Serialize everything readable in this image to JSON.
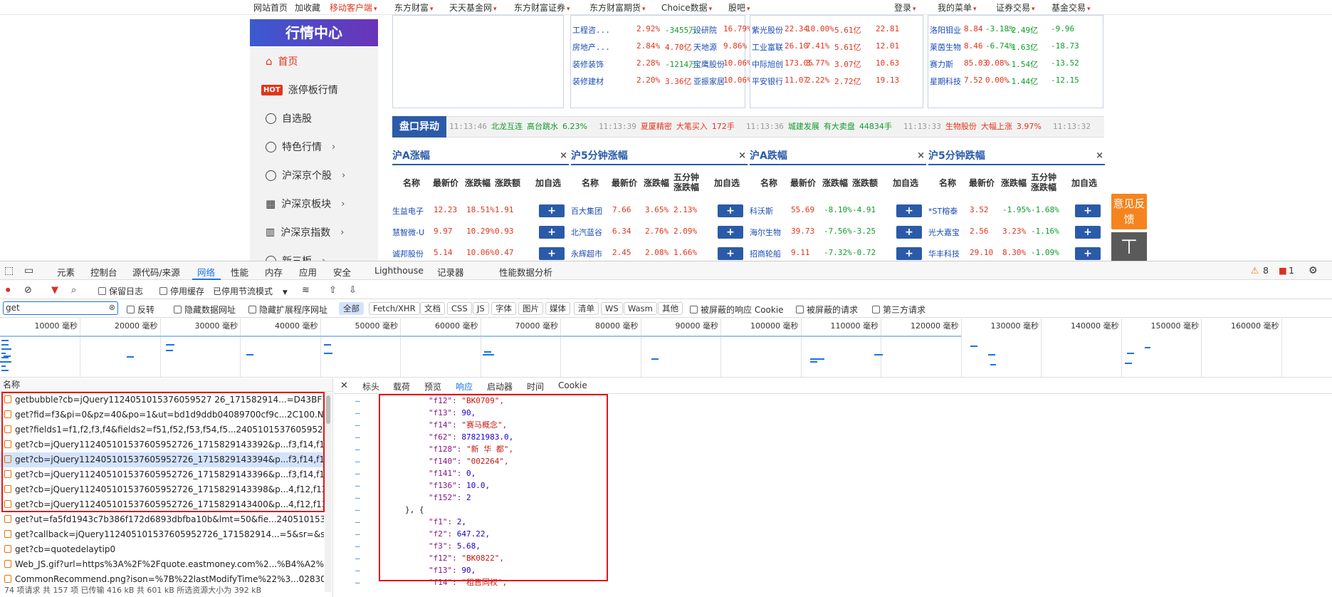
{
  "topnav": {
    "items": [
      "网站首页",
      "加收藏",
      "移动客户端",
      "东方财富",
      "天天基金网",
      "东方财富证券",
      "东方财富期货",
      "Choice数据",
      "股吧",
      "登录",
      "我的菜单",
      "证券交易",
      "基金交易"
    ]
  },
  "logo": "行情中心",
  "sidebar": {
    "items": [
      "首页",
      "涨停板行情",
      "自选股",
      "特色行情",
      "沪深京个股",
      "沪深京板块",
      "沪深京指数",
      "新三板"
    ],
    "hot": "HOT"
  },
  "top_tables": {
    "col1": [
      [
        "工程咨...",
        "2.92%",
        "-3455万",
        "设研院",
        "16.79%"
      ],
      [
        "房地产...",
        "2.84%",
        "4.70亿",
        "天地源",
        "9.86%"
      ],
      [
        "装修装饰",
        "2.28%",
        "-1214万",
        "宝鹰股份",
        "10.06%"
      ],
      [
        "装修建材",
        "2.20%",
        "3.36亿",
        "亚振家居",
        "10.06%"
      ]
    ],
    "col2": [
      [
        "紫光股份",
        "22.34",
        "10.00%",
        "5.61亿",
        "22.81"
      ],
      [
        "工业富联",
        "26.10",
        "7.41%",
        "5.61亿",
        "12.01"
      ],
      [
        "中际旭创",
        "173.05",
        "3.77%",
        "3.07亿",
        "10.63"
      ],
      [
        "平安银行",
        "11.07",
        "2.22%",
        "2.72亿",
        "19.13"
      ]
    ],
    "col3": [
      [
        "洛阳钼业",
        "8.84",
        "-3.18%",
        "-2.49亿",
        "-9.96"
      ],
      [
        "莱茵生物",
        "8.46",
        "-6.74%",
        "-1.63亿",
        "-18.73"
      ],
      [
        "赛力斯",
        "85.03",
        "0.08%",
        "-1.54亿",
        "-13.52"
      ],
      [
        "星期科技",
        "7.52",
        "0.00%",
        "-1.44亿",
        "-12.15"
      ]
    ]
  },
  "yidong": {
    "label": "盘口异动",
    "items": [
      [
        "11:13:46",
        "北龙互连",
        "高台跳水",
        "6.23%",
        "green"
      ],
      [
        "11:13:39",
        "夏厦精密",
        "大笔买入",
        "172手",
        "red"
      ],
      [
        "11:13:36",
        "城建发展",
        "有大卖盘",
        "44834手",
        "green"
      ],
      [
        "11:13:33",
        "生物股份",
        "大幅上涨",
        "3.97%",
        "red"
      ],
      [
        "11:13:32",
        "",
        "",
        "",
        ""
      ]
    ]
  },
  "panels": [
    {
      "title": "沪A涨幅",
      "x": "×",
      "headers": [
        "名称",
        "最新价",
        "涨跌幅",
        "涨跌额",
        "加自选"
      ],
      "rows": [
        [
          "生益电子",
          "12.23",
          "18.51%",
          "1.91"
        ],
        [
          "慧智微-U",
          "9.97",
          "10.29%",
          "0.93"
        ],
        [
          "诚邦股份",
          "5.14",
          "10.06%",
          "0.47"
        ]
      ]
    },
    {
      "title": "沪5分钟涨幅",
      "x": "×",
      "headers": [
        "名称",
        "最新价",
        "涨跌幅",
        "五分钟涨跌幅",
        "加自选"
      ],
      "rows": [
        [
          "百大集团",
          "7.66",
          "3.65%",
          "2.13%"
        ],
        [
          "北汽蓝谷",
          "6.34",
          "2.76%",
          "2.09%"
        ],
        [
          "永辉超市",
          "2.45",
          "2.08%",
          "1.66%"
        ]
      ]
    },
    {
      "title": "沪A跌幅",
      "x": "×",
      "headers": [
        "名称",
        "最新价",
        "涨跌幅",
        "涨跌额",
        "加自选"
      ],
      "rows": [
        [
          "科沃斯",
          "55.69",
          "-8.10%",
          "-4.91"
        ],
        [
          "海尔生物",
          "39.73",
          "-7.56%",
          "-3.25"
        ],
        [
          "招商轮船",
          "9.11",
          "-7.32%",
          "-0.72"
        ]
      ]
    },
    {
      "title": "沪5分钟跌幅",
      "x": "×",
      "headers": [
        "名称",
        "最新价",
        "涨跌幅",
        "五分钟涨跌幅",
        "加自选"
      ],
      "rows": [
        [
          "*ST榕泰",
          "3.52",
          "-1.95%",
          "-1.68%"
        ],
        [
          "光大嘉宝",
          "2.56",
          "3.23%",
          "-1.16%"
        ],
        [
          "华丰科技",
          "29.10",
          "8.30%",
          "-1.09%"
        ]
      ]
    }
  ],
  "plus": "+",
  "feedback": "意见反馈",
  "totop": "不",
  "devtools": {
    "tabs": [
      "元素",
      "控制台",
      "源代码/来源",
      "网络",
      "性能",
      "内存",
      "应用",
      "安全",
      "Lighthouse",
      "记录器",
      "性能数据分析"
    ],
    "warn": "8",
    "err": "1",
    "toolbar": [
      "保留日志",
      "停用缓存",
      "已停用节流模式"
    ],
    "filter_value": "get",
    "filter_opts": [
      "反转",
      "隐藏数据网址",
      "隐藏扩展程序网址"
    ],
    "chips": [
      "全部",
      "Fetch/XHR",
      "文档",
      "CSS",
      "JS",
      "字体",
      "图片",
      "媒体",
      "清单",
      "WS",
      "Wasm",
      "其他"
    ],
    "filter_opts2": [
      "被屏蔽的响应 Cookie",
      "被屏蔽的请求",
      "第三方请求"
    ],
    "ticks": [
      "10000 毫秒",
      "20000 毫秒",
      "30000 毫秒",
      "40000 毫秒",
      "50000 毫秒",
      "60000 毫秒",
      "70000 毫秒",
      "80000 毫秒",
      "90000 毫秒",
      "100000 毫秒",
      "110000 毫秒",
      "120000 毫秒",
      "130000 毫秒",
      "140000 毫秒",
      "150000 毫秒",
      "160000 毫秒",
      "1700"
    ],
    "name_header": "名称",
    "requests": [
      "getbubble?cb=jQuery1124051015376059527 26_171582914...=D43BF72...",
      "get?fid=f3&pi=0&pz=40&po=1&ut=bd1d9ddb04089700cf9c...2C100.N...",
      "get?fields1=f1,f2,f3,f4&fields2=f51,f52,f53,f54,f5...240510153760595272...",
      "get?cb=jQuery112405101537605952726_1715829143392&p...f3,f14,f12,...",
      "get?cb=jQuery112405101537605952726_1715829143394&p...f3,f14,f12,...",
      "get?cb=jQuery112405101537605952726_1715829143396&p...f3,f14,f12,...",
      "get?cb=jQuery112405101537605952726_1715829143398&p...4,f12,f13,f...",
      "get?cb=jQuery112405101537605952726_1715829143400&p...4,f12,f13,f...",
      "get?ut=fa5fd1943c7b386f172d6893dbfba10b&lmt=50&fie...240510153...",
      "get?callback=jQuery112405101537605952726_171582914...=5&sr=&st...",
      "get?cb=quotedelaytip0",
      "Web_JS.gif?url=https%3A%2F%2Fquote.eastmoney.com%2...%B4%A2%...",
      "CommonRecommend.png?ison=%7B%22lastModifyTime%22%3...02830..."
    ],
    "detail_tabs": [
      "标头",
      "载荷",
      "预览",
      "响应",
      "启动器",
      "时间",
      "Cookie"
    ],
    "code": [
      [
        "\"f12\": ",
        "\"BK0709\",",
        "s"
      ],
      [
        "\"f13\": ",
        "90,",
        "n"
      ],
      [
        "\"f14\": ",
        "\"赛马概念\",",
        "s"
      ],
      [
        "\"f62\": ",
        "87821983.0,",
        "n"
      ],
      [
        "\"f128\": ",
        "\"新 华 都\",",
        "s"
      ],
      [
        "\"f140\": ",
        "\"002264\",",
        "s"
      ],
      [
        "\"f141\": ",
        "0,",
        "n"
      ],
      [
        "\"f136\": ",
        "10.0,",
        "n"
      ],
      [
        "\"f152\": ",
        "2",
        "n"
      ],
      [
        "}, {",
        "",
        ""
      ],
      [
        "\"f1\": ",
        "2,",
        "n"
      ],
      [
        "\"f2\": ",
        "647.22,",
        "n"
      ],
      [
        "\"f3\": ",
        "5.68,",
        "n"
      ],
      [
        "\"f12\": ",
        "\"BK0822\",",
        "s"
      ],
      [
        "\"f13\": ",
        "90,",
        "n"
      ],
      [
        "\"f14\": ",
        "\"租售同权\",",
        "s"
      ]
    ],
    "status": "74 项请求   共 157 项   已传输 416 kB   共 601 kB   所选资源大小为 392 kB"
  },
  "colors": {
    "accent": "#1a73e8",
    "brand": "#e1351c",
    "highlight_box": "#e0161a"
  }
}
